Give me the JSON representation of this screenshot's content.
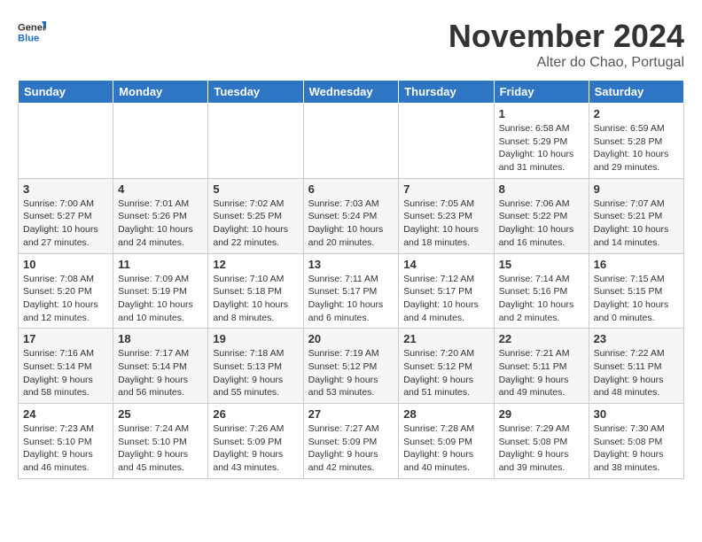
{
  "logo": {
    "line1": "General",
    "line2": "Blue"
  },
  "header": {
    "month": "November 2024",
    "location": "Alter do Chao, Portugal"
  },
  "weekdays": [
    "Sunday",
    "Monday",
    "Tuesday",
    "Wednesday",
    "Thursday",
    "Friday",
    "Saturday"
  ],
  "weeks": [
    [
      {
        "day": "",
        "info": ""
      },
      {
        "day": "",
        "info": ""
      },
      {
        "day": "",
        "info": ""
      },
      {
        "day": "",
        "info": ""
      },
      {
        "day": "",
        "info": ""
      },
      {
        "day": "1",
        "info": "Sunrise: 6:58 AM\nSunset: 5:29 PM\nDaylight: 10 hours\nand 31 minutes."
      },
      {
        "day": "2",
        "info": "Sunrise: 6:59 AM\nSunset: 5:28 PM\nDaylight: 10 hours\nand 29 minutes."
      }
    ],
    [
      {
        "day": "3",
        "info": "Sunrise: 7:00 AM\nSunset: 5:27 PM\nDaylight: 10 hours\nand 27 minutes."
      },
      {
        "day": "4",
        "info": "Sunrise: 7:01 AM\nSunset: 5:26 PM\nDaylight: 10 hours\nand 24 minutes."
      },
      {
        "day": "5",
        "info": "Sunrise: 7:02 AM\nSunset: 5:25 PM\nDaylight: 10 hours\nand 22 minutes."
      },
      {
        "day": "6",
        "info": "Sunrise: 7:03 AM\nSunset: 5:24 PM\nDaylight: 10 hours\nand 20 minutes."
      },
      {
        "day": "7",
        "info": "Sunrise: 7:05 AM\nSunset: 5:23 PM\nDaylight: 10 hours\nand 18 minutes."
      },
      {
        "day": "8",
        "info": "Sunrise: 7:06 AM\nSunset: 5:22 PM\nDaylight: 10 hours\nand 16 minutes."
      },
      {
        "day": "9",
        "info": "Sunrise: 7:07 AM\nSunset: 5:21 PM\nDaylight: 10 hours\nand 14 minutes."
      }
    ],
    [
      {
        "day": "10",
        "info": "Sunrise: 7:08 AM\nSunset: 5:20 PM\nDaylight: 10 hours\nand 12 minutes."
      },
      {
        "day": "11",
        "info": "Sunrise: 7:09 AM\nSunset: 5:19 PM\nDaylight: 10 hours\nand 10 minutes."
      },
      {
        "day": "12",
        "info": "Sunrise: 7:10 AM\nSunset: 5:18 PM\nDaylight: 10 hours\nand 8 minutes."
      },
      {
        "day": "13",
        "info": "Sunrise: 7:11 AM\nSunset: 5:17 PM\nDaylight: 10 hours\nand 6 minutes."
      },
      {
        "day": "14",
        "info": "Sunrise: 7:12 AM\nSunset: 5:17 PM\nDaylight: 10 hours\nand 4 minutes."
      },
      {
        "day": "15",
        "info": "Sunrise: 7:14 AM\nSunset: 5:16 PM\nDaylight: 10 hours\nand 2 minutes."
      },
      {
        "day": "16",
        "info": "Sunrise: 7:15 AM\nSunset: 5:15 PM\nDaylight: 10 hours\nand 0 minutes."
      }
    ],
    [
      {
        "day": "17",
        "info": "Sunrise: 7:16 AM\nSunset: 5:14 PM\nDaylight: 9 hours\nand 58 minutes."
      },
      {
        "day": "18",
        "info": "Sunrise: 7:17 AM\nSunset: 5:14 PM\nDaylight: 9 hours\nand 56 minutes."
      },
      {
        "day": "19",
        "info": "Sunrise: 7:18 AM\nSunset: 5:13 PM\nDaylight: 9 hours\nand 55 minutes."
      },
      {
        "day": "20",
        "info": "Sunrise: 7:19 AM\nSunset: 5:12 PM\nDaylight: 9 hours\nand 53 minutes."
      },
      {
        "day": "21",
        "info": "Sunrise: 7:20 AM\nSunset: 5:12 PM\nDaylight: 9 hours\nand 51 minutes."
      },
      {
        "day": "22",
        "info": "Sunrise: 7:21 AM\nSunset: 5:11 PM\nDaylight: 9 hours\nand 49 minutes."
      },
      {
        "day": "23",
        "info": "Sunrise: 7:22 AM\nSunset: 5:11 PM\nDaylight: 9 hours\nand 48 minutes."
      }
    ],
    [
      {
        "day": "24",
        "info": "Sunrise: 7:23 AM\nSunset: 5:10 PM\nDaylight: 9 hours\nand 46 minutes."
      },
      {
        "day": "25",
        "info": "Sunrise: 7:24 AM\nSunset: 5:10 PM\nDaylight: 9 hours\nand 45 minutes."
      },
      {
        "day": "26",
        "info": "Sunrise: 7:26 AM\nSunset: 5:09 PM\nDaylight: 9 hours\nand 43 minutes."
      },
      {
        "day": "27",
        "info": "Sunrise: 7:27 AM\nSunset: 5:09 PM\nDaylight: 9 hours\nand 42 minutes."
      },
      {
        "day": "28",
        "info": "Sunrise: 7:28 AM\nSunset: 5:09 PM\nDaylight: 9 hours\nand 40 minutes."
      },
      {
        "day": "29",
        "info": "Sunrise: 7:29 AM\nSunset: 5:08 PM\nDaylight: 9 hours\nand 39 minutes."
      },
      {
        "day": "30",
        "info": "Sunrise: 7:30 AM\nSunset: 5:08 PM\nDaylight: 9 hours\nand 38 minutes."
      }
    ]
  ]
}
